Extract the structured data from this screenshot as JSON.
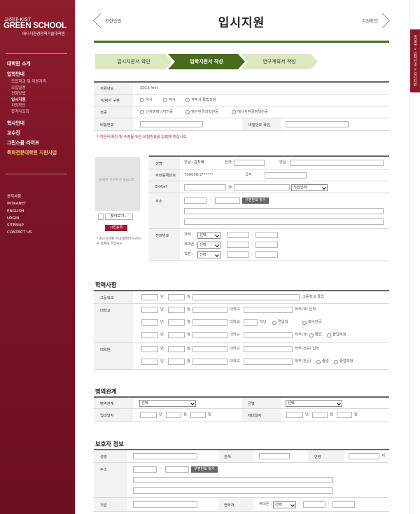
{
  "sidebar": {
    "brand": "고려대·KIST",
    "logo": "GREEN SCHOOL",
    "subtitle": "에너지환경정책기술대학원",
    "menu": [
      "대학원 소개",
      "입학안내"
    ],
    "submenu": [
      "모집학과 및 지원자격",
      "모집일정",
      "전형방법",
      "입시지원",
      "지원확인",
      "합격자조회"
    ],
    "menu2": [
      "학사안내",
      "교수진",
      "그린스쿨 라이프",
      "특화전문대학원 지원사업"
    ],
    "util": [
      "공지사항",
      "INTRANET",
      "ENGLISH",
      "LOGIN",
      "SITEMAP",
      "CONTACT US"
    ]
  },
  "right_tab": "HOME > 입학안내 > 입시지원",
  "header": {
    "prev": "전형방법",
    "title": "입시지원",
    "next": "지원확인"
  },
  "steps": [
    "입시지원서 확인",
    "입학지원서 작성",
    "연구계획서 작성"
  ],
  "form1": {
    "year_label": "지원년도",
    "year_value": "2013 first",
    "degree_label": "석/박사 구분",
    "degree_opts": [
      "석사",
      "박사",
      "석박사 통합과정"
    ],
    "major_label": "전공",
    "major_opts": [
      "신재생에너지전공",
      "첨단환경과학전공",
      "에너지환경정책전공"
    ],
    "pw_label": "비밀번호",
    "pw2_label": "비밀번호 확인",
    "notice": "* 지원서 확인 및 수정을 위한 비밀번호를 입력해 주십시오."
  },
  "photo": {
    "placeholder": "등록된 이미지가 없습니다.",
    "browse": "찾아보기...",
    "register": "사진등록",
    "note": "* 최근 6개월 이내 촬영한 사진으로 등록해 주십시오."
  },
  "personal": {
    "name_label": "성명",
    "kor_label": "한글 :",
    "kor_value": "김지혜",
    "han_label": "한자 :",
    "eng_label": "영문 :",
    "rrn_label": "주민등록번호",
    "rrn_value": "790000-2******",
    "nation_label": "국적",
    "email_label": "E-Mail",
    "at": "@",
    "email_select": "직접입력",
    "addr_label": "주소",
    "zip_btn": "우편번호 찾기",
    "dash": "-",
    "phone_label": "전화번호",
    "home_label": "자택 :",
    "mobile_label": "휴대폰 :",
    "office_label": "직장 :",
    "sel": "선택"
  },
  "edu": {
    "title": "학력사항",
    "hs_label": "고등학교",
    "univ_label": "대학교",
    "grad_label": "대학원",
    "year": "년",
    "month": "월",
    "hs_text": "고등학교 졸업",
    "univ": "대학교",
    "r1": "학부(과) 입학",
    "grade": "학년",
    "transfer": "편입학",
    "double": "복수전공",
    "r3": "학부(과)",
    "grad1": "졸업",
    "grad2": "졸업예정",
    "g1": "학부(전공) 입학",
    "g2": "학부(전공)"
  },
  "military": {
    "title": "병역관계",
    "type_label": "병역관계",
    "branch_label": "군별",
    "enlist_label": "입대일자",
    "discharge_label": "제대일자",
    "sel": "선택",
    "year": "년",
    "month": "월",
    "day": "일"
  },
  "guardian": {
    "title": "보호자 정보",
    "name_label": "성명",
    "rel_label": "관계",
    "age_label": "연령",
    "age_unit": "세",
    "addr_label": "주소",
    "zip_btn": "우편번호 찾기",
    "job_label": "직업",
    "contact_label": "연락처",
    "mobile_label": "휴대폰 :",
    "sel": "선택",
    "dash": "-"
  },
  "colors": {
    "sidebar": "#7a1426",
    "active_step": "#4a6b1e",
    "step": "#dde8bf",
    "accent": "#a01c30"
  }
}
